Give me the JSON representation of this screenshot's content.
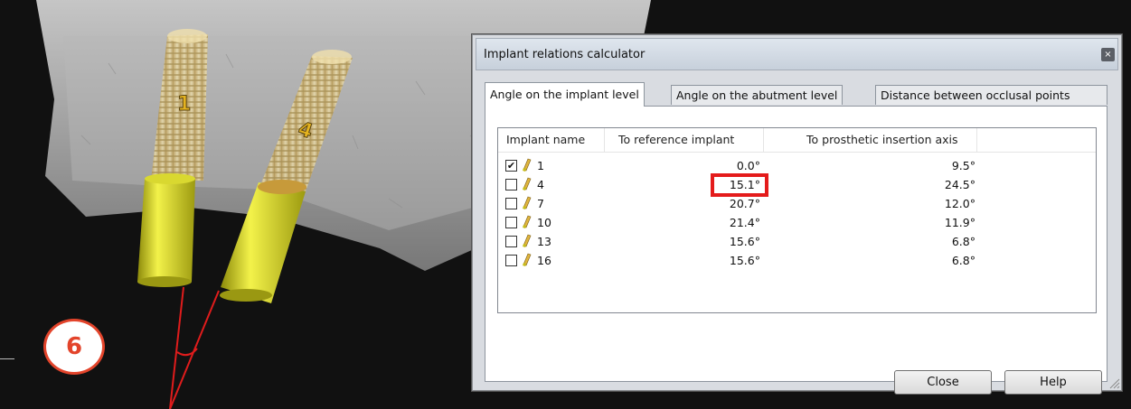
{
  "step_badge": "6",
  "model_labels": [
    "1",
    "4"
  ],
  "dialog": {
    "title": "Implant relations calculator",
    "close_glyph": "×",
    "tabs": [
      {
        "label": "Angle on the implant level",
        "active": true
      },
      {
        "label": "Angle on the abutment level",
        "active": false
      },
      {
        "label": "Distance between occlusal points",
        "active": false
      }
    ],
    "columns": [
      "Implant name",
      "To reference implant",
      "To prosthetic insertion axis"
    ],
    "rows": [
      {
        "checked": true,
        "name": "1",
        "to_reference": "0.0°",
        "to_insertion_axis": "9.5°"
      },
      {
        "checked": false,
        "name": "4",
        "to_reference": "15.1°",
        "to_insertion_axis": "24.5°",
        "highlighted": true
      },
      {
        "checked": false,
        "name": "7",
        "to_reference": "20.7°",
        "to_insertion_axis": "12.0°"
      },
      {
        "checked": false,
        "name": "10",
        "to_reference": "21.4°",
        "to_insertion_axis": "11.9°"
      },
      {
        "checked": false,
        "name": "13",
        "to_reference": "15.6°",
        "to_insertion_axis": "6.8°"
      },
      {
        "checked": false,
        "name": "16",
        "to_reference": "15.6°",
        "to_insertion_axis": "6.8°"
      }
    ],
    "buttons": {
      "close": "Close",
      "help": "Help"
    },
    "check_glyph": "✔"
  },
  "colors": {
    "highlight": "#e41b1b",
    "badge": "#e3442b",
    "implant_gold": "#e0b63e",
    "abutment_yellow": "#e2e22a",
    "axis_lines": "#e01c1c"
  }
}
